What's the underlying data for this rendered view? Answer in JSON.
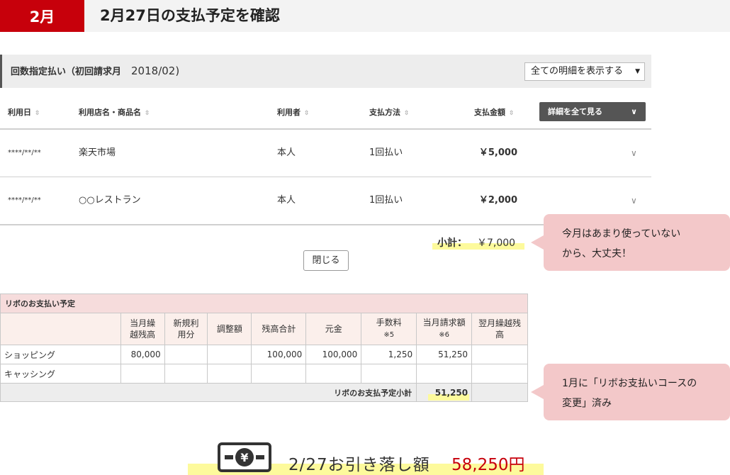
{
  "header": {
    "month_badge": "2月",
    "title": "2月27日の支払予定を確認"
  },
  "section": {
    "title": "回数指定払い（初回請求月",
    "month": "2018/02)",
    "filter_select": "全ての明細を表示する"
  },
  "columns": [
    "利用日",
    "利用店名・商品名",
    "利用者",
    "支払方法",
    "支払金額"
  ],
  "detail_all_button": "詳細を全て見る",
  "transactions": [
    {
      "date": "****/**/**",
      "store": "楽天市場",
      "user": "本人",
      "method": "1回払い",
      "amount": "￥5,000"
    },
    {
      "date": "****/**/**",
      "store": "○○レストラン",
      "user": "本人",
      "method": "1回払い",
      "amount": "￥2,000"
    }
  ],
  "subtotal": {
    "label": "小計：",
    "value": "￥7,000"
  },
  "close_button": "閉じる",
  "bubble1": {
    "line1": "今月はあまり使っていない",
    "line2": "から、大丈夫！"
  },
  "revo": {
    "title": "リボのお支払い予定",
    "headers": [
      {
        "main": "当月繰",
        "sub": "越残高"
      },
      {
        "main": "新規利",
        "sub": "用分"
      },
      {
        "main": "調整額",
        "sub": ""
      },
      {
        "main": "残高合計",
        "sub": ""
      },
      {
        "main": "元金",
        "sub": ""
      },
      {
        "main": "手数料",
        "sub": "※5"
      },
      {
        "main": "当月請求額",
        "sub": "※6"
      },
      {
        "main": "翌月繰越残",
        "sub": "高"
      }
    ],
    "rows": [
      {
        "label": "ショッピング",
        "values": [
          "80,000",
          "",
          "",
          "100,000",
          "100,000",
          "1,250",
          "51,250",
          ""
        ]
      },
      {
        "label": "キャッシング",
        "values": [
          "",
          "",
          "",
          "",
          "",
          "",
          "",
          ""
        ]
      }
    ],
    "subtotal_label": "リボのお支払予定小計",
    "subtotal_value": "51,250"
  },
  "bubble2": {
    "line1": "1月に「リボお支払いコースの",
    "line2": "変更」済み"
  },
  "withdrawal": {
    "label": "2/27お引き落し額",
    "amount": "58,250円"
  },
  "colors": {
    "brand_red": "#c7000b",
    "bubble_pink": "#f3c8c9",
    "highlight_yellow": "#fdfa9c"
  },
  "icons": {
    "sort": "sort-icon",
    "chevron": "chevron-down-icon",
    "yen_card": "yen-card-icon"
  }
}
